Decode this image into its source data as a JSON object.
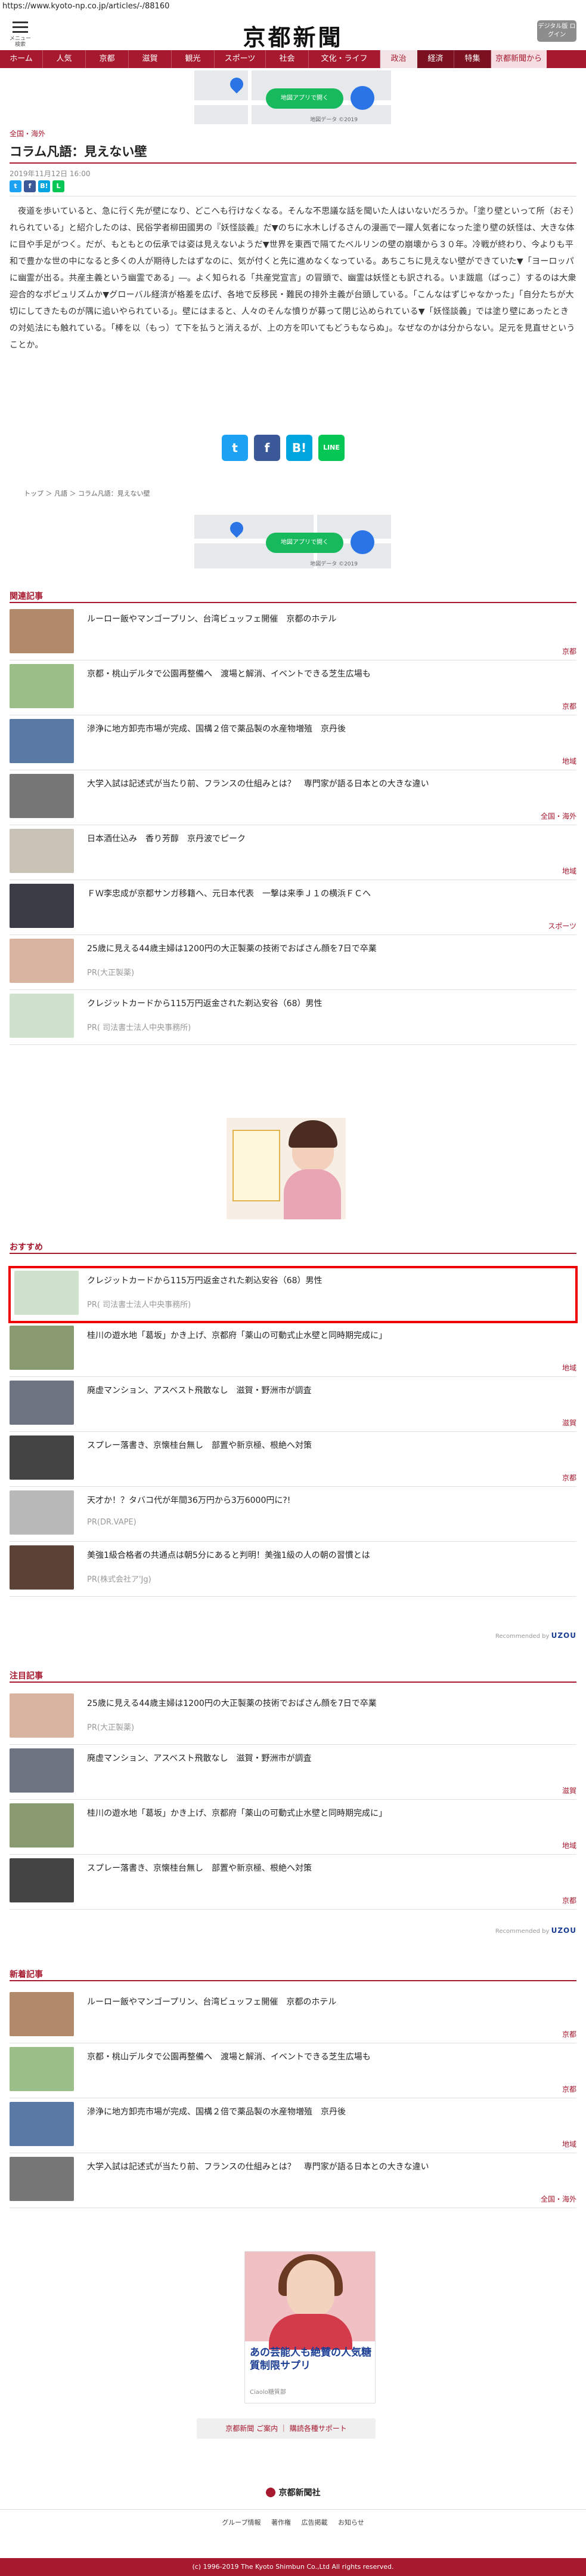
{
  "browser": {
    "url": "https://www.kyoto-np.co.jp/articles/-/88160"
  },
  "header": {
    "menu_label": "メニュー 検索",
    "logo": "京都新聞",
    "digital_button": "デジタル版 ログイン"
  },
  "nav": [
    "ホーム",
    "人気",
    "京都",
    "滋賀",
    "観光",
    "スポーツ",
    "社会",
    "文化・ライフ",
    "政治",
    "経済",
    "特集",
    "京都新聞から"
  ],
  "map_ad": {
    "pill": "地図アプリで開く",
    "credit": "地図データ ©2019"
  },
  "article": {
    "section": "全国・海外",
    "title": "コラム凡語：見えない壁",
    "date": "2019年11月12日 16:00",
    "body": "夜道を歩いていると、急に行く先が壁になり、どこへも行けなくなる。そんな不思議な話を聞いた人はいないだろうか。「塗り壁といって所（おそ）れられている」と紹介したのは、民俗学者柳田國男の『妖怪談義』だ▼のちに水木しげるさんの漫画で一躍人気者になった塗り壁の妖怪は、大きな体に目や手足がつく。だが、もともとの伝承では姿は見えないようだ▼世界を東西で隔てたベルリンの壁の崩壊から３０年。冷戦が終わり、今よりも平和で豊かな世の中になると多くの人が期待したはずなのに、気が付くと先に進めなくなっている。あちこちに見えない壁ができていた▼「ヨーロッパに幽霊が出る。共産主義という幽霊である」―。よく知られる「共産党宣言」の冒頭で、幽霊は妖怪とも訳される。いま跋扈（ばっこ）するのは大衆迎合的なポピュリズムか▼グローバル経済が格差を広げ、各地で反移民・難民の排外主義が台頭している。「こんなはずじゃなかった」「自分たちが大切にしてきたものが隅に追いやられている」。壁にはまると、人々のそんな憤りが募って閉じ込められている▼「妖怪談義」では塗り壁にあったときの対処法にも触れている。「棒を以（もっ）て下を払うと消えるが、上の方を叩いてもどうもならぬ」。なぜなのかは分からない。足元を見直せということか。",
    "breadcrumb": "トップ ＞ 凡語 ＞ コラム凡語：見えない壁"
  },
  "share_big": {
    "twitter": "t",
    "facebook": "f",
    "hatena": "B!",
    "line": "LINE"
  },
  "related": {
    "heading": "関連記事",
    "items": [
      {
        "title": "ルーロー飯やマンゴープリン、台湾ビュッフェ開催　京都のホテル",
        "category": "京都"
      },
      {
        "title": "京都・桃山デルタで公園再整備へ　渡場と解消、イベントできる芝生広場も",
        "category": "京都"
      },
      {
        "title": "滲浄に地方卸売市場が完成、国構２倍で薬品製の水産物増殖　京丹後",
        "category": "地域"
      },
      {
        "title": "大学入試は記述式が当たり前、フランスの仕組みとは？　専門家が語る日本との大きな違い",
        "category": "全国・海外"
      },
      {
        "title": "日本酒仕込み　香り芳醇　京丹波でピーク",
        "category": "地域"
      },
      {
        "title": "ＦＷ李忠成が京都サンガ移籍へ、元日本代表　一撃は来季Ｊ１の横浜ＦＣへ",
        "category": "スポーツ"
      },
      {
        "title": "25歳に見える44歳主婦は1200円の大正製薬の技術でおばさん顔を7日で卒業",
        "pr": "PR(大正製薬)"
      },
      {
        "title": "クレジットカードから115万円返金された剃込安谷（68）男性",
        "pr": "PR( 司法書士法人中央事務所)"
      }
    ]
  },
  "recommend": {
    "heading": "おすすめ",
    "powered": "Recommended by",
    "brand": "UZOU",
    "items": [
      {
        "title": "クレジットカードから115万円返金された剃込安谷（68）男性",
        "pr": "PR( 司法書士法人中央事務所)"
      },
      {
        "title": "桂川の遊水地「葛坂」かき上げ、京都府「薬山の可動式止水壁と同時期完成に」",
        "category": "地域"
      },
      {
        "title": "廃虚マンション、アスベスト飛散なし　滋賀・野洲市が調査",
        "category": "滋賀"
      },
      {
        "title": "スプレー落書き、京懐桂台無し　部置や新京極、根絶へ対策",
        "category": "京都"
      },
      {
        "title": "天才か！？タバコ代が年間36万円から3万6000円に?!",
        "pr": "PR(DR.VAPE)"
      },
      {
        "title": "美強1級合格者の共通点は朝5分にあると判明！美強1級の人の朝の習慣とは",
        "pr": "PR(株式会社ア'Jg)"
      }
    ]
  },
  "attention": {
    "heading": "注目記事",
    "powered": "Recommended by",
    "brand": "UZOU",
    "items": [
      {
        "title": "25歳に見える44歳主婦は1200円の大正製薬の技術でおばさん顔を7日で卒業",
        "pr": "PR(大正製薬)"
      },
      {
        "title": "廃虚マンション、アスベスト飛散なし　滋賀・野洲市が調査",
        "category": "滋賀"
      },
      {
        "title": "桂川の遊水地「葛坂」かき上げ、京都府「薬山の可動式止水壁と同時期完成に」",
        "category": "地域"
      },
      {
        "title": "スプレー落書き、京懐桂台無し　部置や新京極、根絶へ対策",
        "category": "京都"
      }
    ]
  },
  "latest": {
    "heading": "新着記事",
    "items": [
      {
        "title": "ルーロー飯やマンゴープリン、台湾ビュッフェ開催　京都のホテル",
        "category": "京都"
      },
      {
        "title": "京都・桃山デルタで公園再整備へ　渡場と解消、イベントできる芝生広場も",
        "category": "京都"
      },
      {
        "title": "滲浄に地方卸売市場が完成、国構２倍で薬品製の水産物増殖　京丹後",
        "category": "地域"
      },
      {
        "title": "大学入試は記述式が当たり前、フランスの仕組みとは？　専門家が語る日本との大きな違い",
        "category": "全国・海外"
      }
    ]
  },
  "bottom_ad": {
    "headline": "あの芸能人も絶賛の人気糖質制限サプリ",
    "advertiser": "Ciaolo糖質部"
  },
  "footer": {
    "info_links": "京都新聞 ご案内 ｜ 購読各種サポート",
    "logo": "京都新聞社",
    "links": "グループ情報 著作権 広告掲載 お知らせ",
    "copyright": "(c) 1996-2019 The Kyoto Shimbun Co.,Ltd All rights reserved."
  }
}
